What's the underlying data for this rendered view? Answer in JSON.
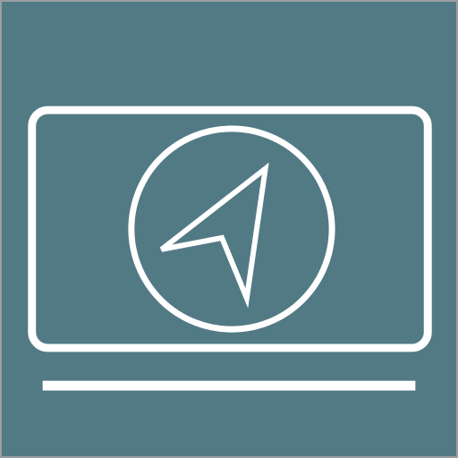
{
  "icon": {
    "name": "navigation-display-icon",
    "colors": {
      "background": "#527a85",
      "stroke": "#ffffff",
      "frame": "#9a9ea2"
    }
  }
}
